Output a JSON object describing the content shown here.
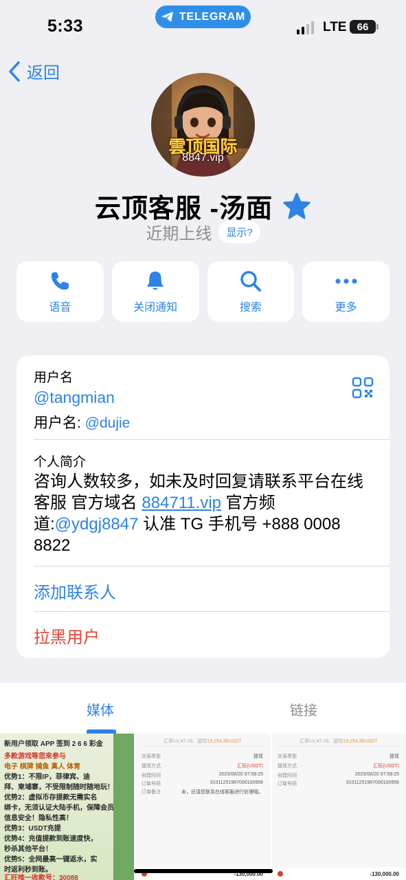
{
  "status_bar": {
    "time": "5:33",
    "app_pill": "TELEGRAM",
    "network": "LTE",
    "battery": "66"
  },
  "nav": {
    "back_label": "返回"
  },
  "profile": {
    "avatar_text_main": "雲顶国际",
    "avatar_text_sub": "8847.vip",
    "name": "云顶客服 -汤面",
    "last_seen": "近期上线",
    "show_button": "显示?"
  },
  "actions": [
    {
      "label": "语音",
      "icon": "phone-icon"
    },
    {
      "label": "关闭通知",
      "icon": "bell-icon"
    },
    {
      "label": "搜索",
      "icon": "search-icon"
    },
    {
      "label": "更多",
      "icon": "more-icon"
    }
  ],
  "info": {
    "username_label": "用户名",
    "username": "@tangmian",
    "alt_username_prefix": "用户名: ",
    "alt_username": "@dujie",
    "bio_label": "个人简介",
    "bio_part1": "咨询人数较多，如未及时回复请联系平台在线客服 官方域名 ",
    "bio_domain": "884711.vip",
    "bio_part2": " 官方频道:",
    "bio_channel": "@ydgj8847",
    "bio_part3": " 认准 TG 手机号 +888 0008 8822",
    "add_contact": "添加联系人",
    "block_user": "拉黑用户"
  },
  "tabs": {
    "media": "媒体",
    "links": "链接"
  },
  "media_thumbs": {
    "promo_lines": [
      "新用户领取 APP 签到 2 6 6 彩金",
      "多款游戏等您来参与",
      "电子 棋牌 捕鱼 真人 体育",
      "优势1：不限IP，菲律宾、迪",
      "拜、柬埔寨，不受限制随时随地玩！",
      "优势2：虚拟币存提款无需实名",
      "绑卡，无须认证大陆手机，保障会员",
      "信息安全！隐私性高！",
      "优势3：USDT充提",
      "优势4：充值提款到账速度快，",
      "秒杀其他平台！",
      "优势5：全网最高一键返水，实",
      "时返利秒到账。",
      "汇旺唯一收款号：30088"
    ],
    "record_header_a": "汇率U1:¥7.26，提现",
    "record_header_b": "19,254.38USDT",
    "record_rows": [
      {
        "k": "交易类型",
        "v": "提现"
      },
      {
        "k": "提现方式",
        "v": "汇旺(USDT)"
      },
      {
        "k": "创建时间",
        "v": "2025/06/20 07:58:25"
      },
      {
        "k": "订单号码",
        "v": "31011251987000100956"
      },
      {
        "k": "订单备注",
        "v": "未，还请您联系在线客服进行处理哦。"
      }
    ],
    "record_rows_b": [
      {
        "k": "交易类型",
        "v": "提现"
      },
      {
        "k": "提现方式",
        "v": "汇旺(USDT)"
      },
      {
        "k": "创建时间",
        "v": "2025/06/20 07:58:25"
      },
      {
        "k": "订单号码",
        "v": "31011251987000100956"
      }
    ],
    "footer_amount": "-130,000.00"
  }
}
